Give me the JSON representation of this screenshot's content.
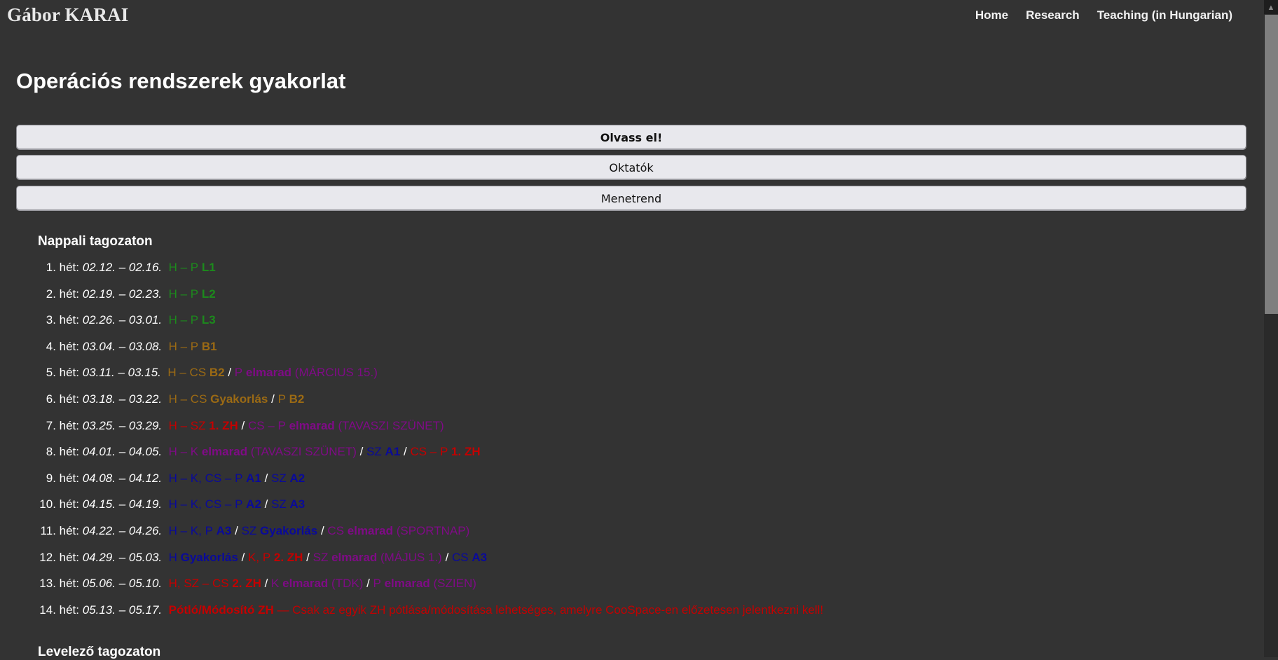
{
  "header": {
    "logo": "Gábor KARAI",
    "nav": [
      {
        "label": "Home"
      },
      {
        "label": "Research"
      },
      {
        "label": "Teaching (in Hungarian)"
      }
    ]
  },
  "page_title": "Operációs rendszerek gyakorlat",
  "buttons": [
    {
      "label": "Olvass el!"
    },
    {
      "label": "Oktatók"
    },
    {
      "label": "Menetrend"
    }
  ],
  "colors": {
    "background": "#333333",
    "lab": "#1c8a1c",
    "bash": "#9b6a14",
    "cancelled": "#7f0b86",
    "assignment": "#0a0a9a",
    "exam": "#c40000"
  },
  "sections": {
    "day": "Nappali tagozaton",
    "correspondence": "Levelező tagozaton"
  },
  "week_label": "hét:",
  "weeks": [
    {
      "n": "1.",
      "dates": "02.12. – 02.16.",
      "parts": [
        {
          "t": "H – P ",
          "c": "green"
        },
        {
          "t": "L1",
          "c": "green",
          "b": true
        }
      ]
    },
    {
      "n": "2.",
      "dates": "02.19. – 02.23.",
      "parts": [
        {
          "t": "H – P ",
          "c": "green"
        },
        {
          "t": "L2",
          "c": "green",
          "b": true
        }
      ]
    },
    {
      "n": "3.",
      "dates": "02.26. – 03.01.",
      "parts": [
        {
          "t": "H – P ",
          "c": "green"
        },
        {
          "t": "L3",
          "c": "green",
          "b": true
        }
      ]
    },
    {
      "n": "4.",
      "dates": "03.04. – 03.08.",
      "parts": [
        {
          "t": "H – P ",
          "c": "brown"
        },
        {
          "t": "B1",
          "c": "brown",
          "b": true
        }
      ]
    },
    {
      "n": "5.",
      "dates": "03.11. – 03.15.",
      "parts": [
        {
          "t": "H – CS ",
          "c": "brown"
        },
        {
          "t": "B2",
          "c": "brown",
          "b": true
        },
        {
          "t": " / ",
          "c": "sep"
        },
        {
          "t": "P ",
          "c": "purple"
        },
        {
          "t": "elmarad",
          "c": "purple",
          "b": true
        },
        {
          "t": " (MÁRCIUS 15.)",
          "c": "purple"
        }
      ]
    },
    {
      "n": "6.",
      "dates": "03.18. – 03.22.",
      "parts": [
        {
          "t": "H – CS ",
          "c": "brown"
        },
        {
          "t": "Gyakorlás",
          "c": "brown",
          "b": true
        },
        {
          "t": " / ",
          "c": "sep"
        },
        {
          "t": "P ",
          "c": "brown"
        },
        {
          "t": "B2",
          "c": "brown",
          "b": true
        }
      ]
    },
    {
      "n": "7.",
      "dates": "03.25. – 03.29.",
      "parts": [
        {
          "t": "H – SZ ",
          "c": "red"
        },
        {
          "t": "1. ZH",
          "c": "red",
          "b": true
        },
        {
          "t": " / ",
          "c": "sep"
        },
        {
          "t": "CS – P ",
          "c": "purple"
        },
        {
          "t": "elmarad",
          "c": "purple",
          "b": true
        },
        {
          "t": " (TAVASZI SZÜNET)",
          "c": "purple"
        }
      ]
    },
    {
      "n": "8.",
      "dates": "04.01. – 04.05.",
      "parts": [
        {
          "t": "H – K ",
          "c": "purple"
        },
        {
          "t": "elmarad",
          "c": "purple",
          "b": true
        },
        {
          "t": " (TAVASZI SZÜNET)",
          "c": "purple"
        },
        {
          "t": " / ",
          "c": "sep"
        },
        {
          "t": "SZ ",
          "c": "blue"
        },
        {
          "t": "A1",
          "c": "blue",
          "b": true
        },
        {
          "t": " / ",
          "c": "sep"
        },
        {
          "t": "CS – P ",
          "c": "red"
        },
        {
          "t": "1. ZH",
          "c": "red",
          "b": true
        }
      ]
    },
    {
      "n": "9.",
      "dates": "04.08. – 04.12.",
      "parts": [
        {
          "t": "H – K, CS – P ",
          "c": "blue"
        },
        {
          "t": "A1",
          "c": "blue",
          "b": true
        },
        {
          "t": " / ",
          "c": "sep"
        },
        {
          "t": "SZ ",
          "c": "blue"
        },
        {
          "t": "A2",
          "c": "blue",
          "b": true
        }
      ]
    },
    {
      "n": "10.",
      "dates": "04.15. – 04.19.",
      "parts": [
        {
          "t": "H – K, CS – P ",
          "c": "blue"
        },
        {
          "t": "A2",
          "c": "blue",
          "b": true
        },
        {
          "t": " / ",
          "c": "sep"
        },
        {
          "t": "SZ ",
          "c": "blue"
        },
        {
          "t": "A3",
          "c": "blue",
          "b": true
        }
      ]
    },
    {
      "n": "11.",
      "dates": "04.22. – 04.26.",
      "parts": [
        {
          "t": "H – K, P ",
          "c": "blue"
        },
        {
          "t": "A3",
          "c": "blue",
          "b": true
        },
        {
          "t": " / ",
          "c": "sep"
        },
        {
          "t": "SZ ",
          "c": "blue"
        },
        {
          "t": "Gyakorlás",
          "c": "blue",
          "b": true
        },
        {
          "t": " / ",
          "c": "sep"
        },
        {
          "t": "CS ",
          "c": "purple"
        },
        {
          "t": "elmarad",
          "c": "purple",
          "b": true
        },
        {
          "t": " (SPORTNAP)",
          "c": "purple"
        }
      ]
    },
    {
      "n": "12.",
      "dates": "04.29. – 05.03.",
      "parts": [
        {
          "t": "H ",
          "c": "blue"
        },
        {
          "t": "Gyakorlás",
          "c": "blue",
          "b": true
        },
        {
          "t": " / ",
          "c": "sep"
        },
        {
          "t": "K, P ",
          "c": "red"
        },
        {
          "t": "2. ZH",
          "c": "red",
          "b": true
        },
        {
          "t": " / ",
          "c": "sep"
        },
        {
          "t": "SZ ",
          "c": "purple"
        },
        {
          "t": "elmarad",
          "c": "purple",
          "b": true
        },
        {
          "t": " (MÁJUS 1.)",
          "c": "purple"
        },
        {
          "t": " / ",
          "c": "sep"
        },
        {
          "t": "CS ",
          "c": "blue"
        },
        {
          "t": "A3",
          "c": "blue",
          "b": true
        }
      ]
    },
    {
      "n": "13.",
      "dates": "05.06. – 05.10.",
      "parts": [
        {
          "t": "H, SZ – CS ",
          "c": "red"
        },
        {
          "t": "2. ZH",
          "c": "red",
          "b": true
        },
        {
          "t": " / ",
          "c": "sep"
        },
        {
          "t": "K ",
          "c": "purple"
        },
        {
          "t": "elmarad",
          "c": "purple",
          "b": true
        },
        {
          "t": " (TDK)",
          "c": "purple"
        },
        {
          "t": " / ",
          "c": "sep"
        },
        {
          "t": "P ",
          "c": "purple"
        },
        {
          "t": "elmarad",
          "c": "purple",
          "b": true
        },
        {
          "t": " (SZIEN)",
          "c": "purple"
        }
      ]
    },
    {
      "n": "14.",
      "dates": "05.13. – 05.17.",
      "parts": [
        {
          "t": "Pótló/Módosító ZH",
          "c": "red",
          "b": true
        },
        {
          "t": " — Csak az egyik ZH pótlása/módosítása lehetséges, amelyre CooSpace-en előzetesen jelentkezni kell!",
          "c": "red"
        }
      ]
    }
  ]
}
